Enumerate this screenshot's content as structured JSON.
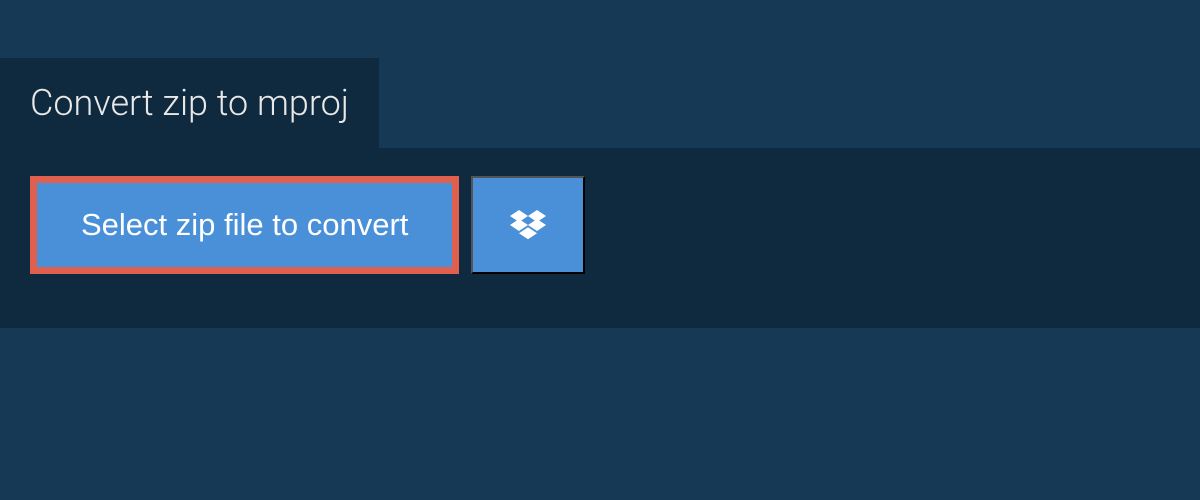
{
  "header": {
    "title": "Convert zip to mproj"
  },
  "actions": {
    "select_label": "Select zip file to convert"
  }
}
